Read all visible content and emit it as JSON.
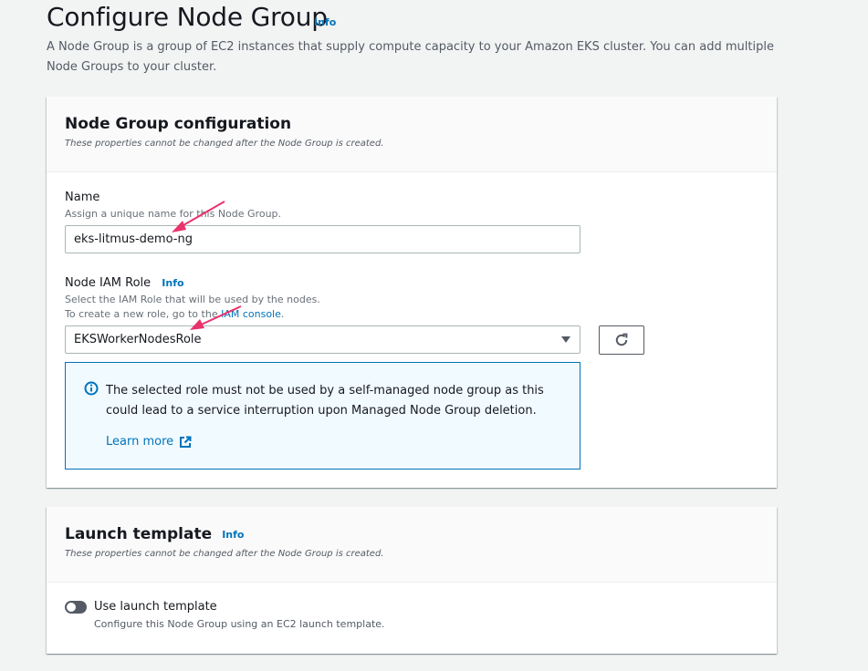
{
  "header": {
    "title": "Configure Node Group",
    "info": "Info",
    "description": "A Node Group is a group of EC2 instances that supply compute capacity to your Amazon EKS cluster. You can add multiple Node Groups to your cluster."
  },
  "node_group_config": {
    "title": "Node Group configuration",
    "subtitle": "These properties cannot be changed after the Node Group is created.",
    "name": {
      "label": "Name",
      "description": "Assign a unique name for this Node Group.",
      "value": "eks-litmus-demo-ng"
    },
    "iam_role": {
      "label": "Node IAM Role",
      "info": "Info",
      "description_line1": "Select the IAM Role that will be used by the nodes.",
      "description_line2_prefix": "To create a new role, go to the ",
      "description_link": "IAM console",
      "description_line2_suffix": ".",
      "selected": "EKSWorkerNodesRole"
    },
    "alert": {
      "text": "The selected role must not be used by a self-managed node group as this could lead to a service interruption upon Managed Node Group deletion.",
      "link": "Learn more"
    }
  },
  "launch_template": {
    "title": "Launch template",
    "info": "Info",
    "subtitle": "These properties cannot be changed after the Node Group is created.",
    "toggle_label": "Use launch template",
    "toggle_description": "Configure this Node Group using an EC2 launch template.",
    "toggle_on": false
  },
  "colors": {
    "link": "#0073bb",
    "annotation_arrow": "#e8336b",
    "alert_bg": "#f1faff"
  }
}
